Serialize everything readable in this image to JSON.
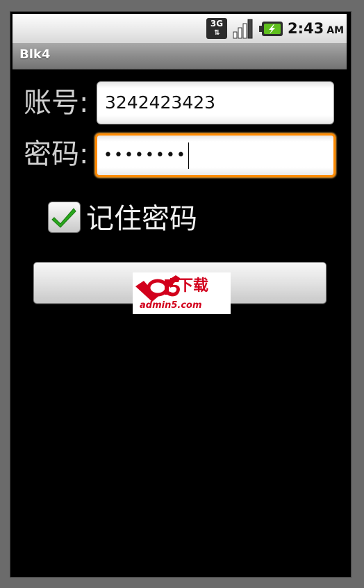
{
  "status_bar": {
    "network_type": "3G",
    "network_arrows": "⇅",
    "time": "2:43",
    "ampm": "AM",
    "signal_icon": "signal-bars-icon",
    "battery_icon": "battery-charging-icon",
    "battery_color": "#5fbf1e"
  },
  "app": {
    "title": "Blk4"
  },
  "form": {
    "account_label": "账号:",
    "account_value": "3242423423",
    "password_label": "密码:",
    "password_masked": "••••••••",
    "remember_label": "记住密码",
    "remember_checked": true,
    "focus_color": "#ff8a00"
  },
  "login_button": {
    "logo_text_cn": "下载",
    "logo_url": "admin5.com",
    "logo_mark": "a5",
    "logo_color": "#d2001c"
  }
}
